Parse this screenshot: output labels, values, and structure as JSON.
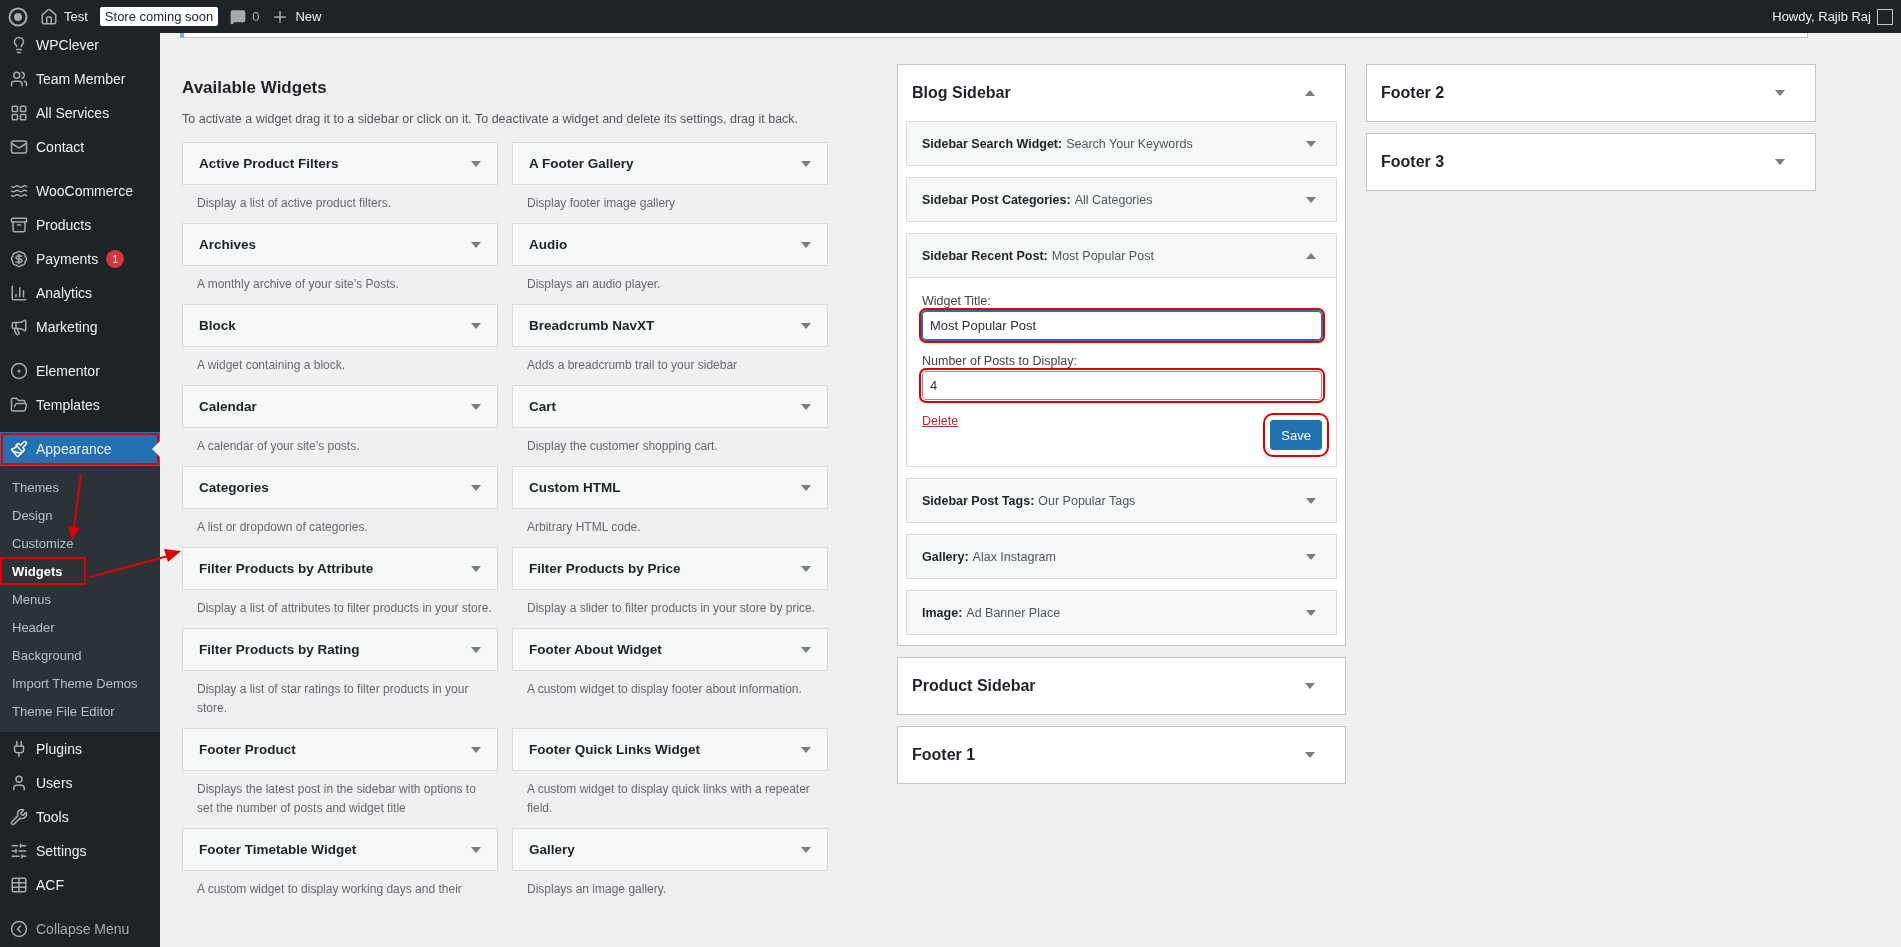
{
  "top_bar": {
    "site_name": "Test",
    "store_badge": "Store coming soon",
    "comments_count": "0",
    "new_label": "New",
    "greeting": "Howdy, Rajib Raj"
  },
  "sidebar": {
    "groups": [
      [
        {
          "label": "WPClever",
          "selected": false
        },
        {
          "label": "Team Member",
          "selected": false
        },
        {
          "label": "All Services",
          "selected": false
        },
        {
          "label": "Contact",
          "selected": false
        }
      ],
      [
        {
          "label": "WooCommerce",
          "selected": false
        },
        {
          "label": "Products",
          "selected": false
        },
        {
          "label": "Payments",
          "selected": false,
          "badge": "1"
        },
        {
          "label": "Analytics",
          "selected": false
        },
        {
          "label": "Marketing",
          "selected": false
        }
      ],
      [
        {
          "label": "Elementor",
          "selected": false
        },
        {
          "label": "Templates",
          "selected": false
        }
      ],
      [
        {
          "label": "Appearance",
          "selected": true,
          "annotated": true,
          "children": [
            {
              "label": "Themes",
              "selected": false
            },
            {
              "label": "Design",
              "selected": false
            },
            {
              "label": "Customize",
              "selected": false
            },
            {
              "label": "Widgets",
              "selected": true,
              "annotated": true
            },
            {
              "label": "Menus",
              "selected": false
            },
            {
              "label": "Header",
              "selected": false
            },
            {
              "label": "Background",
              "selected": false
            },
            {
              "label": "Import Theme Demos",
              "selected": false
            },
            {
              "label": "Theme File Editor",
              "selected": false
            }
          ]
        },
        {
          "label": "Plugins",
          "selected": false
        },
        {
          "label": "Users",
          "selected": false
        },
        {
          "label": "Tools",
          "selected": false
        },
        {
          "label": "Settings",
          "selected": false
        },
        {
          "label": "ACF",
          "selected": false
        }
      ]
    ],
    "collapse_label": "Collapse Menu"
  },
  "available_widgets": {
    "title": "Available Widgets",
    "description": "To activate a widget drag it to a sidebar or click on it. To deactivate a widget and delete its settings, drag it back.",
    "widgets": [
      {
        "title": "Active Product Filters",
        "description": "Display a list of active product filters."
      },
      {
        "title": "A Footer Gallery",
        "description": "Display footer image gallery"
      },
      {
        "title": "Archives",
        "description": "A monthly archive of your site’s Posts."
      },
      {
        "title": "Audio",
        "description": "Displays an audio player."
      },
      {
        "title": "Block",
        "description": "A widget containing a block."
      },
      {
        "title": "Breadcrumb NavXT",
        "description": "Adds a breadcrumb trail to your sidebar"
      },
      {
        "title": "Calendar",
        "description": "A calendar of your site’s posts."
      },
      {
        "title": "Cart",
        "description": "Display the customer shopping cart."
      },
      {
        "title": "Categories",
        "description": "A list or dropdown of categories."
      },
      {
        "title": "Custom HTML",
        "description": "Arbitrary HTML code."
      },
      {
        "title": "Filter Products by Attribute",
        "description": "Display a list of attributes to filter products in your store."
      },
      {
        "title": "Filter Products by Price",
        "description": "Display a slider to filter products in your store by price."
      },
      {
        "title": "Filter Products by Rating",
        "description": "Display a list of star ratings to filter products in your store."
      },
      {
        "title": "Footer About Widget",
        "description": "A custom widget to display footer about information."
      },
      {
        "title": "Footer Product",
        "description": "Displays the latest post in the sidebar with options to set the number of posts and widget title"
      },
      {
        "title": "Footer Quick Links Widget",
        "description": "A custom widget to display quick links with a repeater field."
      },
      {
        "title": "Footer Timetable Widget",
        "description": "A custom widget to display working days and their"
      },
      {
        "title": "Gallery",
        "description": "Displays an image gallery."
      }
    ]
  },
  "sidebar_columns": [
    [
      {
        "title": "Blog Sidebar",
        "expanded": true,
        "widgets": [
          {
            "name": "Sidebar Search Widget:",
            "title": "Search Your Keywords",
            "expanded": false
          },
          {
            "name": "Sidebar Post Categories:",
            "title": "All Categories",
            "expanded": false
          },
          {
            "name": "Sidebar Recent Post:",
            "title": "Most Popular Post",
            "expanded": true,
            "fields": [
              {
                "label": "Widget Title:",
                "value": "Most Popular Post",
                "focused": true,
                "annotated": true
              },
              {
                "label": "Number of Posts to Display:",
                "value": "4",
                "focused": false,
                "annotated": true
              }
            ],
            "delete_label": "Delete",
            "save_label": "Save",
            "save_annotated": true
          },
          {
            "name": "Sidebar Post Tags:",
            "title": "Our Popular Tags",
            "expanded": false
          },
          {
            "name": "Gallery:",
            "title": "Alax Instagram",
            "expanded": false
          },
          {
            "name": "Image:",
            "title": "Ad Banner Place",
            "expanded": false
          }
        ]
      },
      {
        "title": "Product Sidebar",
        "expanded": false
      },
      {
        "title": "Footer 1",
        "expanded": false
      }
    ],
    [
      {
        "title": "Footer 2",
        "expanded": false
      },
      {
        "title": "Footer 3",
        "expanded": false
      }
    ]
  ]
}
